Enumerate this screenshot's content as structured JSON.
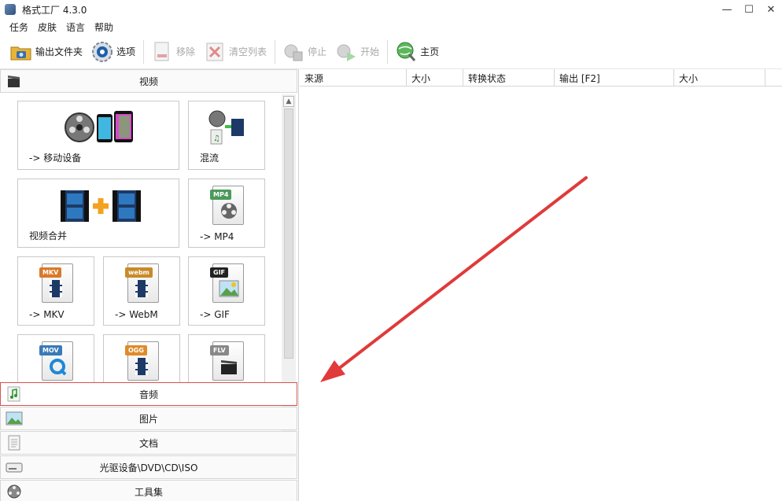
{
  "window": {
    "title": "格式工厂 4.3.0",
    "minimize": "—",
    "maximize": "☐",
    "close": "✕"
  },
  "menu": [
    "任务",
    "皮肤",
    "语言",
    "帮助"
  ],
  "toolbar": {
    "output_folder": "输出文件夹",
    "options": "选项",
    "remove": "移除",
    "clear_list": "清空列表",
    "stop": "停止",
    "start": "开始",
    "home": "主页"
  },
  "categories": {
    "video": "视频",
    "audio": "音频",
    "image": "图片",
    "document": "文档",
    "disc": "光驱设备\\DVD\\CD\\ISO",
    "tools": "工具集"
  },
  "video_tiles": {
    "mobile": "-> 移动设备",
    "mux": "混流",
    "join": "视频合并",
    "mp4": "-> MP4",
    "mkv": "-> MKV",
    "webm": "-> WebM",
    "gif": "-> GIF"
  },
  "badges": {
    "mp4": "MP4",
    "mkv": "MKV",
    "webm": "webm",
    "gif": "GIF",
    "mov": "MOV",
    "ogg": "OGG",
    "flv": "FLV"
  },
  "table": {
    "columns": [
      "来源",
      "大小",
      "转换状态",
      "输出 [F2]",
      "大小"
    ]
  },
  "colors": {
    "arrow": "#e03a3a",
    "selected_border": "#d95050",
    "badge_mp4": "#4a9a5a",
    "badge_mkv": "#d9792a",
    "badge_webm": "#c98a2a",
    "badge_gif": "#222222",
    "badge_mov": "#3a7ab8",
    "badge_ogg": "#e08a2a",
    "badge_flv": "#888888"
  },
  "icons": {
    "app": "format-factory-icon",
    "output_folder": "folder-icon",
    "options": "gear-icon",
    "remove": "remove-doc-icon",
    "clear_list": "clear-x-icon",
    "stop": "stop-icon",
    "start": "start-icon",
    "home": "globe-icon"
  }
}
